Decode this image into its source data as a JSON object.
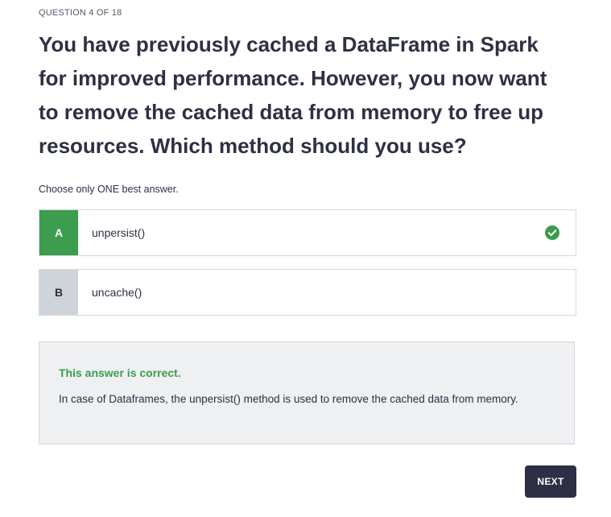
{
  "quiz": {
    "counter": "QUESTION 4 OF 18",
    "question": "You have previously cached a DataFrame in Spark for improved performance. However, you now want to remove the cached data from memory to free up resources. Which method should you use?",
    "instruction": "Choose only ONE best answer.",
    "options": [
      {
        "letter": "A",
        "text": "unpersist()",
        "state": "selected-correct"
      },
      {
        "letter": "B",
        "text": "uncache()",
        "state": "unselected"
      }
    ],
    "feedback": {
      "status": "This answer is correct.",
      "explanation": "In case of Dataframes, the unpersist() method is used to remove the cached data from memory."
    },
    "next_label": "NEXT"
  },
  "colors": {
    "correct": "#3b9d4d",
    "button": "#2d2f45",
    "option_b_badge": "#cfd3da",
    "feedback_bg": "#eff0f2"
  },
  "icons": {
    "correct_indicator": "check-circle-icon"
  }
}
